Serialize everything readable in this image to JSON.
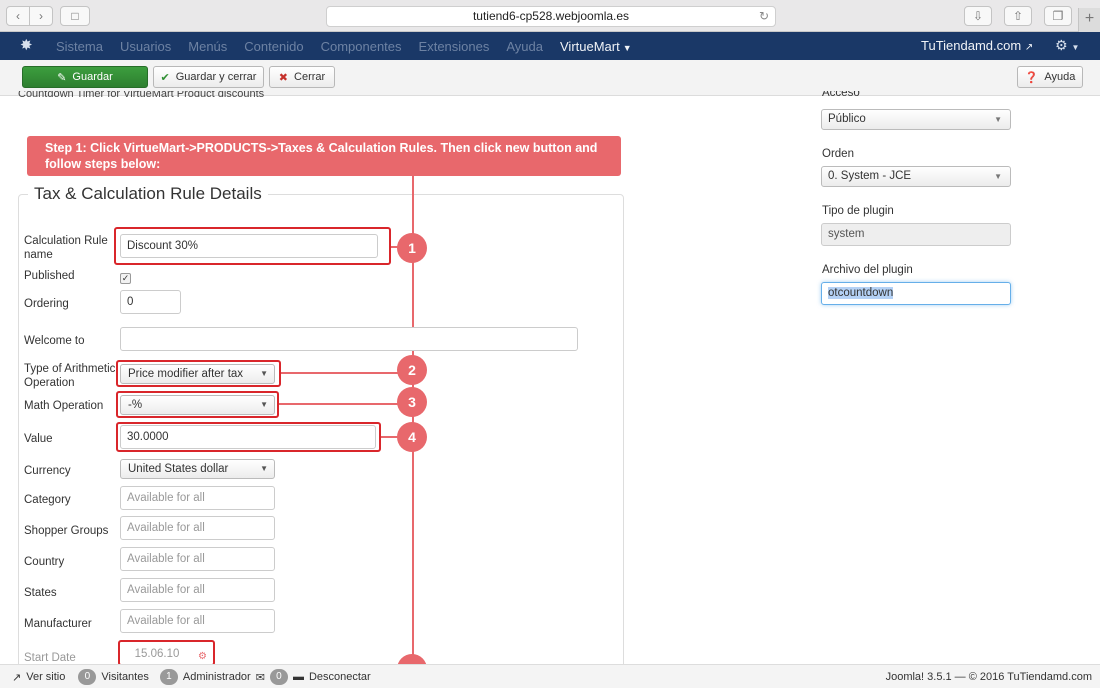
{
  "browser": {
    "url": "tutiend6-cp528.webjoomla.es"
  },
  "adminbar": {
    "menu": [
      "Sistema",
      "Usuarios",
      "Menús",
      "Contenido",
      "Componentes",
      "Extensiones",
      "Ayuda"
    ],
    "virtuemart": "VirtueMart",
    "site_link": "TuTiendamd.com"
  },
  "toolbar": {
    "save": "Guardar",
    "save_close": "Guardar y cerrar",
    "close": "Cerrar",
    "help": "Ayuda"
  },
  "main": {
    "description": "Countdown Timer for VirtueMart Product discounts",
    "banner": "Step 1: Click VirtueMart->PRODUCTS->Taxes & Calculation Rules. Then click new button and follow steps below:",
    "legend": "Tax & Calculation Rule Details",
    "fields": {
      "rule_name_label": "Calculation Rule name",
      "rule_name_value": "Discount 30%",
      "published_label": "Published",
      "ordering_label": "Ordering",
      "ordering_value": "0",
      "welcome_label": "Welcome to",
      "arith_label": "Type of Arithmetic Operation",
      "arith_value": "Price modifier after tax",
      "math_label": "Math Operation",
      "math_value": "-%",
      "value_label": "Value",
      "value_value": "30.0000",
      "currency_label": "Currency",
      "currency_value": "United States dollar",
      "category_label": "Category",
      "shopper_label": "Shopper Groups",
      "country_label": "Country",
      "states_label": "States",
      "manufacturer_label": "Manufacturer",
      "available_placeholder": "Available for all",
      "start_label": "Start Date",
      "start_value": "15.06.10"
    },
    "steps": [
      "1",
      "2",
      "3",
      "4"
    ]
  },
  "right": {
    "acceso_label": "Acceso",
    "acceso_value": "Público",
    "orden_label": "Orden",
    "orden_value": "0. System - JCE",
    "tipo_label": "Tipo de plugin",
    "tipo_value": "system",
    "archivo_label": "Archivo del plugin",
    "archivo_value": "otcountdown"
  },
  "statusbar": {
    "ver_sitio": "Ver sitio",
    "visitantes_count": "0",
    "visitantes": "Visitantes",
    "admin_count": "1",
    "admin": "Administrador",
    "msg_count": "0",
    "desconectar": "Desconectar",
    "footer": "Joomla! 3.5.1  —  © 2016 TuTiendamd.com"
  },
  "colors": {
    "adminbar": "#1a3867",
    "save_green": "#3c9e3e",
    "annotation": "#e8686c",
    "highlight": "#d9262b"
  }
}
